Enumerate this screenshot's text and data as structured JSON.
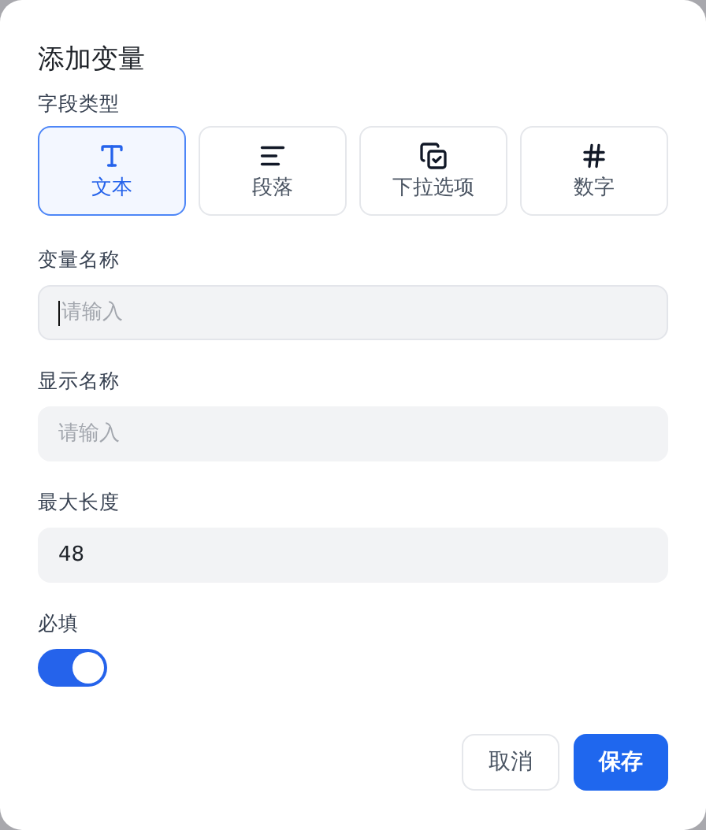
{
  "dialog": {
    "title": "添加变量"
  },
  "field_type": {
    "label": "字段类型",
    "options": [
      {
        "kind": "text",
        "label": "文本",
        "selected": true
      },
      {
        "kind": "paragraph",
        "label": "段落",
        "selected": false
      },
      {
        "kind": "dropdown",
        "label": "下拉选项",
        "selected": false
      },
      {
        "kind": "number",
        "label": "数字",
        "selected": false
      }
    ]
  },
  "fields": [
    {
      "label": "变量名称",
      "placeholder": "请输入",
      "focused": true
    },
    {
      "label": "显示名称",
      "placeholder": "请输入",
      "focused": false
    },
    {
      "label": "最大长度",
      "value": "48",
      "focused": false
    }
  ],
  "required": {
    "label": "必填",
    "on": true
  },
  "buttons": [
    {
      "kind": "secondary",
      "label": "取消"
    },
    {
      "kind": "primary",
      "label": "保存"
    }
  ]
}
